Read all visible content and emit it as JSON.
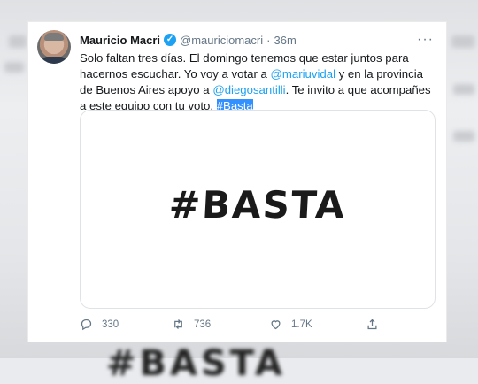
{
  "tweet": {
    "author_name": "Mauricio Macri",
    "handle": "@mauriciomacri",
    "separator": "·",
    "time": "36m",
    "more_label": "···",
    "text_1": "Solo faltan tres días. El domingo tenemos que estar juntos para hacernos escuchar. Yo voy a votar a ",
    "mention_1": "@mariuvidal",
    "text_2": " y en la provincia de Buenos Aires apoyo a ",
    "mention_2": "@diegosantilli",
    "text_3": ". Te invito a que acompañes a este equipo con tu voto. ",
    "hashtag": "#Basta",
    "image_text": "#BASTA"
  },
  "actions": {
    "reply_count": "330",
    "retweet_count": "736",
    "like_count": "1.7K"
  },
  "colors": {
    "accent": "#1da1f2",
    "selection": "#3390ff",
    "muted": "#657786"
  }
}
